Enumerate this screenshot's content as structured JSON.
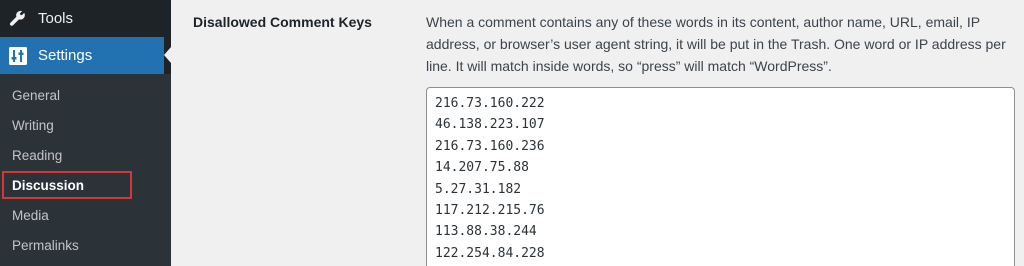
{
  "sidebar": {
    "tools_label": "Tools",
    "settings_label": "Settings",
    "submenu": [
      {
        "label": "General",
        "current": false
      },
      {
        "label": "Writing",
        "current": false
      },
      {
        "label": "Reading",
        "current": false
      },
      {
        "label": "Discussion",
        "current": true
      },
      {
        "label": "Media",
        "current": false
      },
      {
        "label": "Permalinks",
        "current": false
      }
    ],
    "tools_icon": "wrench-icon",
    "settings_icon": "settings-sliders-icon",
    "highlight_color": "#d63638",
    "active_color": "#2271b1"
  },
  "main": {
    "field_label": "Disallowed Comment Keys",
    "description": "When a comment contains any of these words in its content, author name, URL, email, IP address, or browser’s user agent string, it will be put in the Trash. One word or IP address per line. It will match inside words, so “press” will match “WordPress”.",
    "disallowed_keys": [
      "216.73.160.222",
      "46.138.223.107",
      "216.73.160.236",
      "14.207.75.88",
      "5.27.31.182",
      "117.212.215.76",
      "113.88.38.244",
      "122.254.84.228"
    ]
  }
}
